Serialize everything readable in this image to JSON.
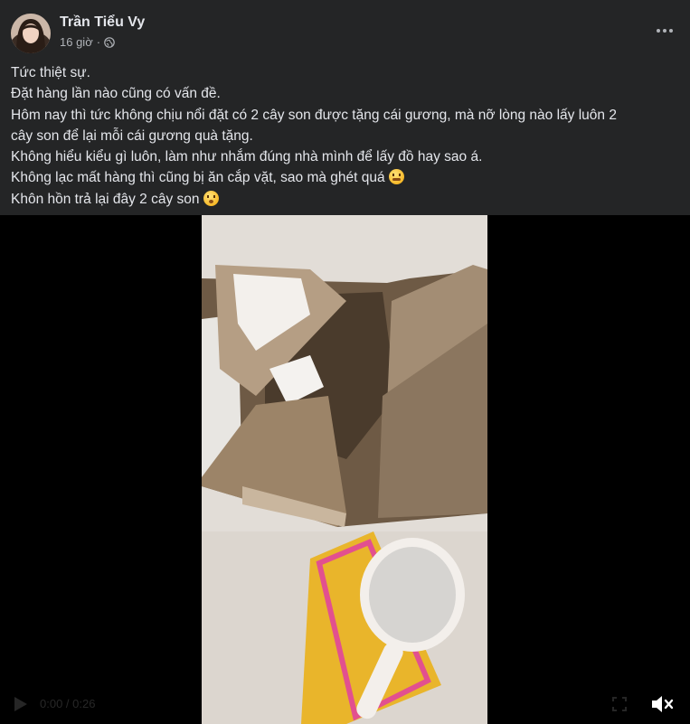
{
  "post": {
    "author": "Trần Tiểu Vy",
    "timestamp": "16 giờ",
    "separator": "·",
    "privacy_icon": "globe-icon",
    "lines": [
      "Tức thiệt sự.",
      "Đặt hàng lần nào cũng có vấn đề.",
      "Hôm nay thì tức không chịu nổi đặt có 2 cây son được tặng cái gương, mà nỡ lòng nào lấy luôn 2",
      "cây son để lại mỗi cái gương quà tặng.",
      "Không hiểu kiểu gì luôn, làm như nhắm đúng nhà mình để lấy đồ hay sao á.",
      "Không lạc mất hàng thì cũng bị ăn cắp vặt, sao mà ghét quá",
      "Khôn hồn trả lại đây 2 cây son"
    ],
    "emoji_line6": "steaming-angry-face-emoji",
    "emoji_line7": "flushed-face-emoji"
  },
  "video": {
    "time_label": "0:00 / 0:26",
    "mute_icon": "speaker-muted-icon"
  },
  "colors": {
    "background": "#242526",
    "text_primary": "#e4e6eb",
    "text_secondary": "#b0b3b8",
    "media_bg": "#000000"
  }
}
